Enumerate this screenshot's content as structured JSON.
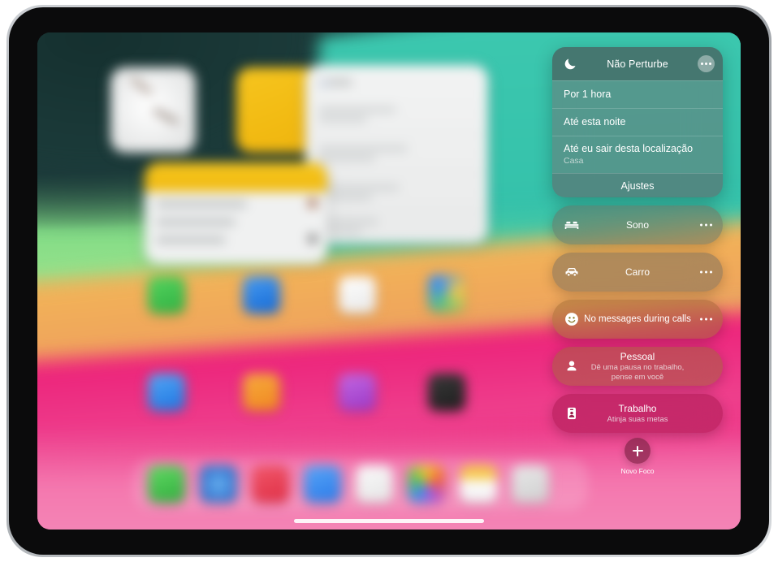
{
  "device": {
    "name": "ipad"
  },
  "wallpaper": {
    "colors": [
      "#1e3b3c",
      "#39c7ae",
      "#83dd87",
      "#eeb05f",
      "#ec2f7f",
      "#f47bb0"
    ]
  },
  "focus_panel": {
    "active_focus": {
      "name": "Não Perturbe",
      "icon": "moon-icon",
      "more_label": "•••",
      "options": [
        {
          "title": "Por 1 hora",
          "subtitle": ""
        },
        {
          "title": "Até esta noite",
          "subtitle": ""
        },
        {
          "title": "Até eu sair desta localização",
          "subtitle": "Casa"
        }
      ],
      "settings_label": "Ajustes"
    },
    "modes": [
      {
        "name": "Sono",
        "subtitle": "",
        "icon": "bed-icon",
        "has_more": true,
        "style": "gray"
      },
      {
        "name": "Carro",
        "subtitle": "",
        "icon": "car-icon",
        "has_more": true,
        "style": "gray"
      },
      {
        "name": "No messages during calls",
        "subtitle": "",
        "icon": "smiley-icon",
        "has_more": true,
        "style": "olive",
        "two_line": true
      },
      {
        "name": "Pessoal",
        "subtitle": "Dê uma pausa no trabalho, pense em você",
        "icon": "person-icon",
        "has_more": false,
        "style": "olive"
      },
      {
        "name": "Trabalho",
        "subtitle": "Atinja suas metas",
        "icon": "badge-icon",
        "has_more": false,
        "style": "pink"
      }
    ],
    "new_focus": {
      "label": "Novo Foco",
      "icon": "plus-icon"
    }
  },
  "home_screen": {
    "widgets": [
      {
        "name": "clock-widget"
      },
      {
        "name": "yellow-widget"
      },
      {
        "name": "list-widget"
      },
      {
        "name": "notes-widget"
      }
    ],
    "app_icons": [
      {
        "name": "app-green",
        "color": "#3cc04a"
      },
      {
        "name": "app-blue",
        "color": "#1f7fe8"
      },
      {
        "name": "app-white",
        "color": "#f1f1f1"
      },
      {
        "name": "app-maps",
        "color": "#4da56a"
      },
      {
        "name": "app-appstore",
        "color": "#2f8bf2"
      },
      {
        "name": "app-orange",
        "color": "#f0922a"
      },
      {
        "name": "app-purple",
        "color": "#b054d6"
      },
      {
        "name": "app-dark",
        "color": "#2a2a2a"
      }
    ],
    "dock_icons": [
      {
        "name": "dock-messages",
        "color": "#4cc157"
      },
      {
        "name": "dock-safari",
        "color": "#3f8fe3"
      },
      {
        "name": "dock-music",
        "color": "#e8465a"
      },
      {
        "name": "dock-mail",
        "color": "#3a8ef0"
      },
      {
        "name": "dock-notes",
        "color": "#ededed"
      },
      {
        "name": "dock-photos",
        "color": "#f5f5f5"
      },
      {
        "name": "dock-files",
        "color": "#f4c64a"
      },
      {
        "name": "dock-extra",
        "color": "#dcdcdc"
      }
    ]
  }
}
